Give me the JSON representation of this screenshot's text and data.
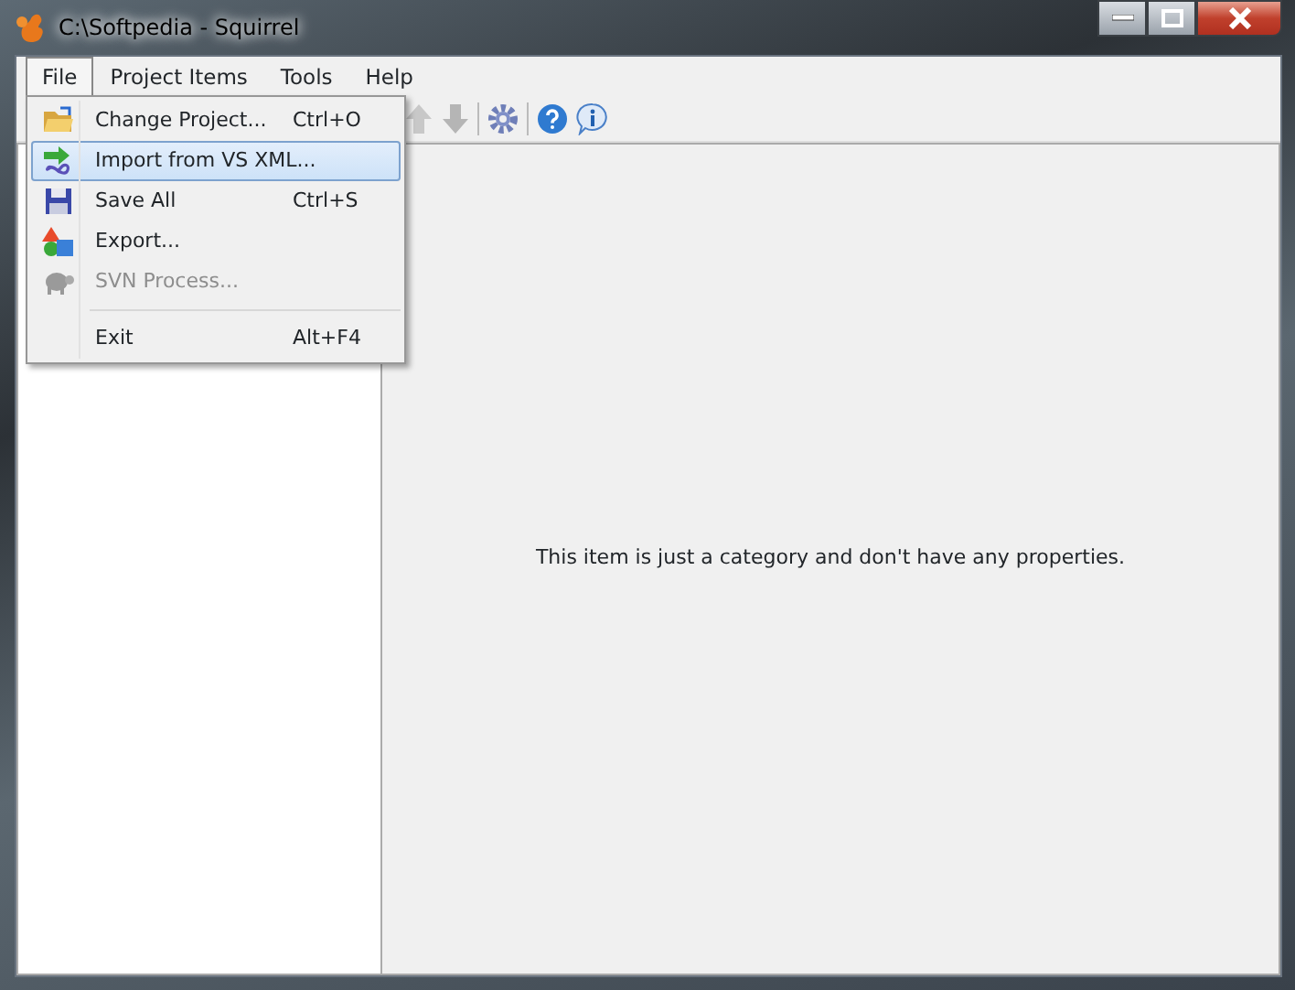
{
  "window": {
    "title": "C:\\Softpedia - Squirrel"
  },
  "menu_bar": [
    {
      "label": "File",
      "selected": true
    },
    {
      "label": "Project Items",
      "selected": false
    },
    {
      "label": "Tools",
      "selected": false
    },
    {
      "label": "Help",
      "selected": false
    }
  ],
  "file_menu": [
    {
      "kind": "item",
      "label": "Change Project...",
      "shortcut": "Ctrl+O",
      "selected": false,
      "disabled": false
    },
    {
      "kind": "item",
      "label": "Import from VS XML...",
      "selected": true,
      "disabled": false
    },
    {
      "kind": "item",
      "label": "Save All",
      "shortcut": "Ctrl+S",
      "selected": false,
      "disabled": false
    },
    {
      "kind": "item",
      "label": "Export...",
      "selected": false,
      "disabled": false
    },
    {
      "kind": "item",
      "label": "SVN Process...",
      "selected": false,
      "disabled": true
    },
    {
      "kind": "separator"
    },
    {
      "kind": "item",
      "label": "Exit",
      "shortcut": "Alt+F4",
      "selected": false,
      "disabled": false
    }
  ],
  "properties_message": "This item is just a category and don't have any properties."
}
